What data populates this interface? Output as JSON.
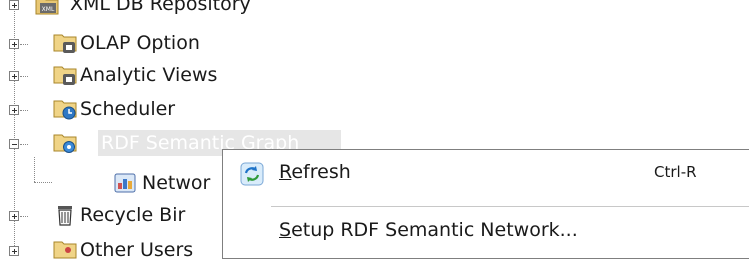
{
  "tree": {
    "items": [
      {
        "label": "XML DB Repository",
        "icon": "xml-folder-icon",
        "expander": "plus"
      },
      {
        "label": "OLAP Option",
        "icon": "olap-folder-icon",
        "expander": "plus"
      },
      {
        "label": "Analytic Views",
        "icon": "analytic-views-folder-icon",
        "expander": "plus"
      },
      {
        "label": "Scheduler",
        "icon": "scheduler-folder-icon",
        "expander": "plus"
      },
      {
        "label": "RDF Semantic Graph",
        "icon": "rdf-folder-icon",
        "expander": "minus"
      },
      {
        "label": "Networ",
        "icon": "network-icon",
        "expander": "none"
      },
      {
        "label": "Recycle Bir",
        "icon": "recycle-bin-icon",
        "expander": "plus"
      },
      {
        "label": "Other Users",
        "icon": "other-users-folder-icon",
        "expander": "plus"
      }
    ]
  },
  "context_menu": {
    "items": [
      {
        "mnemonic": "R",
        "rest": "efresh",
        "shortcut": "Ctrl-R",
        "icon": "refresh-icon"
      },
      {
        "mnemonic": "S",
        "rest": "etup RDF Semantic Network...",
        "shortcut": "",
        "icon": ""
      }
    ]
  },
  "colors": {
    "selection_bg": "#e6e6e6",
    "selection_text": "#ffffff",
    "menu_border": "#7f7f7f"
  }
}
